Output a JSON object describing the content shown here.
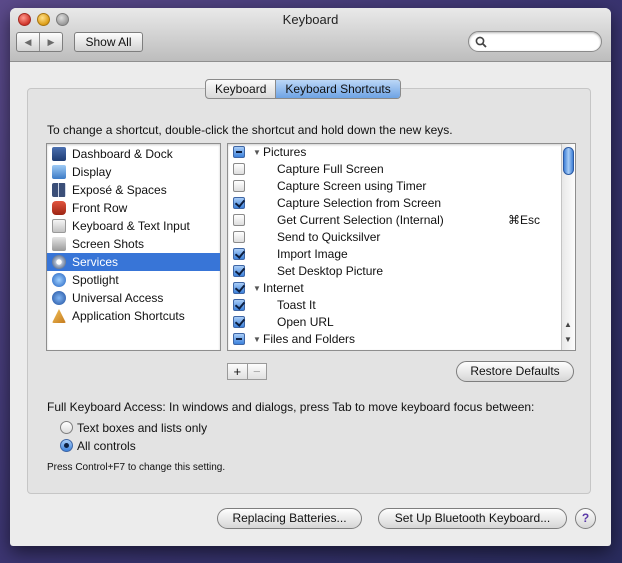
{
  "window": {
    "title": "Keyboard"
  },
  "toolbar": {
    "back_icon": "back-arrow-icon",
    "forward_icon": "forward-arrow-icon",
    "show_all_label": "Show All",
    "search_placeholder": ""
  },
  "tabs": [
    {
      "label": "Keyboard",
      "active": false
    },
    {
      "label": "Keyboard Shortcuts",
      "active": true
    }
  ],
  "instructions": "To change a shortcut, double-click the shortcut and hold down the new keys.",
  "categories": [
    {
      "label": "Dashboard & Dock",
      "icon": "dashboard-icon",
      "selected": false
    },
    {
      "label": "Display",
      "icon": "display-icon",
      "selected": false
    },
    {
      "label": "Exposé & Spaces",
      "icon": "expose-icon",
      "selected": false
    },
    {
      "label": "Front Row",
      "icon": "front-row-icon",
      "selected": false
    },
    {
      "label": "Keyboard & Text Input",
      "icon": "keyboard-icon",
      "selected": false
    },
    {
      "label": "Screen Shots",
      "icon": "screenshot-icon",
      "selected": false
    },
    {
      "label": "Services",
      "icon": "gear-icon",
      "selected": true
    },
    {
      "label": "Spotlight",
      "icon": "spotlight-icon",
      "selected": false
    },
    {
      "label": "Universal Access",
      "icon": "universal-access-icon",
      "selected": false
    },
    {
      "label": "Application Shortcuts",
      "icon": "app-shortcuts-icon",
      "selected": false
    }
  ],
  "shortcuts": [
    {
      "type": "group",
      "label": "Pictures",
      "state": "mixed",
      "shortcut": ""
    },
    {
      "type": "item",
      "label": "Capture Full Screen",
      "state": "unchecked",
      "shortcut": ""
    },
    {
      "type": "item",
      "label": "Capture Screen using Timer",
      "state": "unchecked",
      "shortcut": ""
    },
    {
      "type": "item",
      "label": "Capture Selection from Screen",
      "state": "checked",
      "shortcut": ""
    },
    {
      "type": "item",
      "label": "Get Current Selection (Internal)",
      "state": "unchecked",
      "shortcut": "⌘Esc"
    },
    {
      "type": "item",
      "label": "Send to Quicksilver",
      "state": "unchecked",
      "shortcut": ""
    },
    {
      "type": "item",
      "label": "Import Image",
      "state": "checked",
      "shortcut": ""
    },
    {
      "type": "item",
      "label": "Set Desktop Picture",
      "state": "checked",
      "shortcut": ""
    },
    {
      "type": "group",
      "label": "Internet",
      "state": "checked",
      "shortcut": ""
    },
    {
      "type": "item",
      "label": "Toast It",
      "state": "checked",
      "shortcut": ""
    },
    {
      "type": "item",
      "label": "Open URL",
      "state": "checked",
      "shortcut": ""
    },
    {
      "type": "group",
      "label": "Files and Folders",
      "state": "mixed",
      "shortcut": ""
    }
  ],
  "list_controls": {
    "add_label": "+",
    "remove_label": "−"
  },
  "restore_defaults_label": "Restore Defaults",
  "full_keyboard_access": {
    "label": "Full Keyboard Access: In windows and dialogs, press Tab to move keyboard focus between:",
    "options": [
      {
        "label": "Text boxes and lists only",
        "selected": false
      },
      {
        "label": "All controls",
        "selected": true
      }
    ],
    "hint": "Press Control+F7 to change this setting."
  },
  "buttons": {
    "replacing_batteries": "Replacing Batteries...",
    "bluetooth_setup": "Set Up Bluetooth Keyboard...",
    "help": "?"
  },
  "colors": {
    "selection": "#3875d7",
    "accent_blue": "#3d82dc"
  }
}
